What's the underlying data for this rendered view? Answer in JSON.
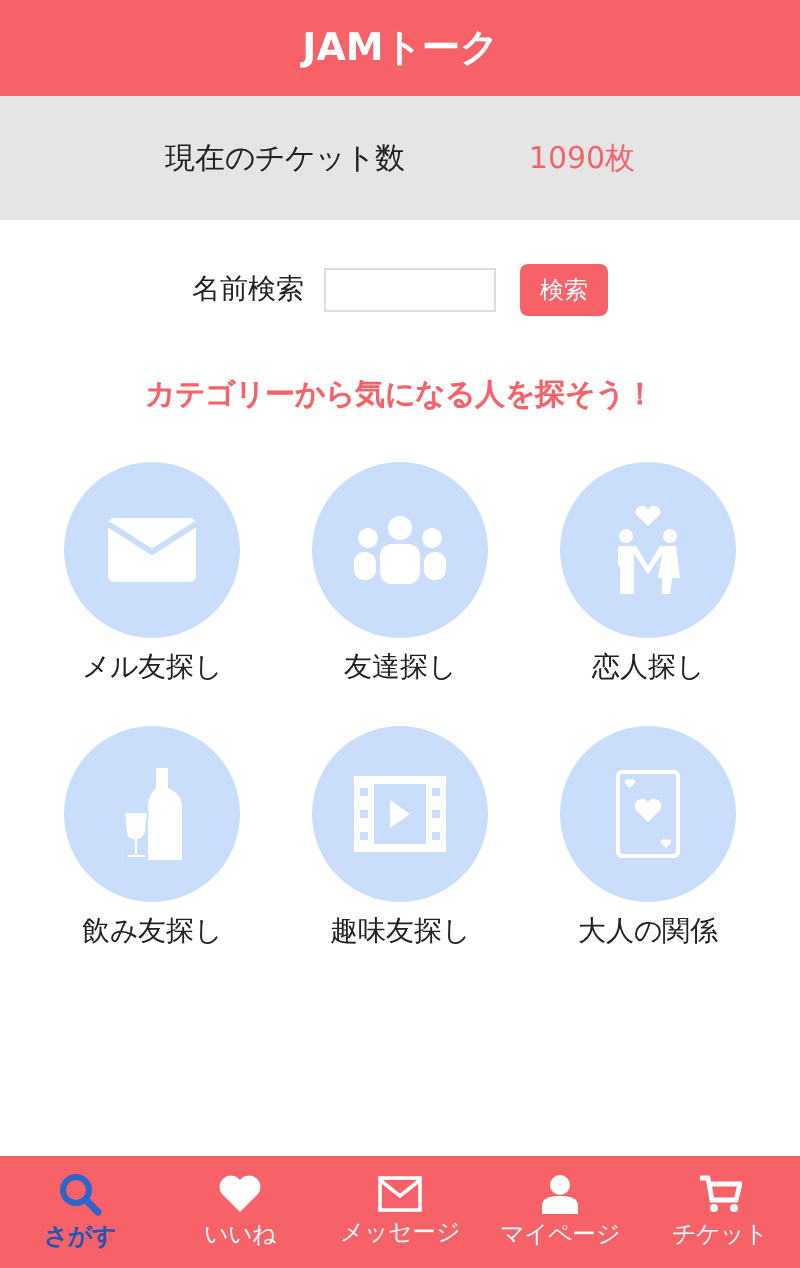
{
  "header": {
    "title": "JAMトーク"
  },
  "tickets": {
    "label": "現在のチケット数",
    "count": "1090枚"
  },
  "search": {
    "label": "名前検索",
    "button": "検索"
  },
  "headline": "カテゴリーから気になる人を探そう！",
  "categories": [
    {
      "kind": "mail",
      "label": "メル友探し"
    },
    {
      "kind": "group",
      "label": "友達探し"
    },
    {
      "kind": "couple",
      "label": "恋人探し"
    },
    {
      "kind": "drink",
      "label": "飲み友探し"
    },
    {
      "kind": "film",
      "label": "趣味友探し"
    },
    {
      "kind": "card",
      "label": "大人の関係"
    }
  ],
  "nav": [
    {
      "kind": "search",
      "label": "さがす",
      "selected": true
    },
    {
      "kind": "heart",
      "label": "いいね",
      "selected": false
    },
    {
      "kind": "mail",
      "label": "メッセージ",
      "selected": false
    },
    {
      "kind": "user",
      "label": "マイページ",
      "selected": false
    },
    {
      "kind": "cart",
      "label": "チケット",
      "selected": false
    }
  ]
}
